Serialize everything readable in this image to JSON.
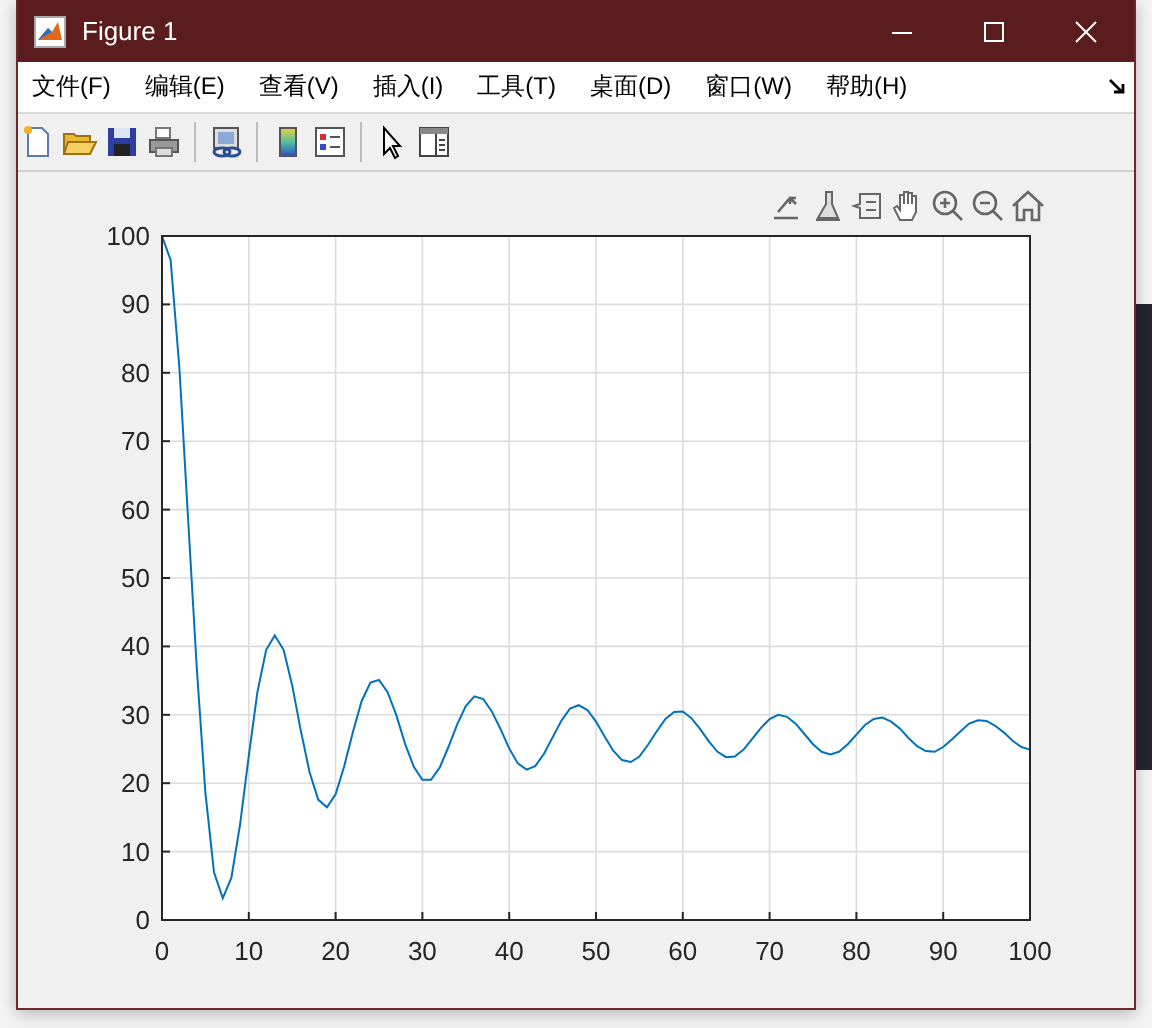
{
  "window": {
    "title": "Figure 1"
  },
  "menu": [
    "文件(F)",
    "编辑(E)",
    "查看(V)",
    "插入(I)",
    "工具(T)",
    "桌面(D)",
    "窗口(W)",
    "帮助(H)"
  ],
  "chart_data": {
    "type": "line",
    "grid": true,
    "xlim": [
      0,
      100
    ],
    "ylim": [
      0,
      100
    ],
    "xticks": [
      0,
      10,
      20,
      30,
      40,
      50,
      60,
      70,
      80,
      90,
      100
    ],
    "yticks": [
      0,
      10,
      20,
      30,
      40,
      50,
      60,
      70,
      80,
      90,
      100
    ],
    "x": [
      0,
      1,
      2,
      3,
      4,
      5,
      6,
      7,
      8,
      9,
      10,
      11,
      12,
      13,
      14,
      15,
      16,
      17,
      18,
      19,
      20,
      21,
      22,
      23,
      24,
      25,
      26,
      27,
      28,
      29,
      30,
      31,
      32,
      33,
      34,
      35,
      36,
      37,
      38,
      39,
      40,
      41,
      42,
      43,
      44,
      45,
      46,
      47,
      48,
      49,
      50,
      51,
      52,
      53,
      54,
      55,
      56,
      57,
      58,
      59,
      60,
      61,
      62,
      63,
      64,
      65,
      66,
      67,
      68,
      69,
      70,
      71,
      72,
      73,
      74,
      75,
      76,
      77,
      78,
      79,
      80,
      81,
      82,
      83,
      84,
      85,
      86,
      87,
      88,
      89,
      90,
      91,
      92,
      93,
      94,
      95,
      96,
      97,
      98,
      99,
      100
    ],
    "series": [
      {
        "color": "#0072bd",
        "values": [
          100,
          96.5,
          80.7,
          58.9,
          36.8,
          18.6,
          7.0,
          3.2,
          6.2,
          14.1,
          24.0,
          33.3,
          39.5,
          41.6,
          39.5,
          34.3,
          27.7,
          21.6,
          17.6,
          16.5,
          18.4,
          22.5,
          27.5,
          32.0,
          34.7,
          35.1,
          33.3,
          29.9,
          25.8,
          22.4,
          20.5,
          20.5,
          22.3,
          25.3,
          28.6,
          31.3,
          32.7,
          32.3,
          30.5,
          27.9,
          25.1,
          22.9,
          22.0,
          22.5,
          24.3,
          26.7,
          29.1,
          30.9,
          31.4,
          30.7,
          29.0,
          26.8,
          24.7,
          23.4,
          23.1,
          23.9,
          25.6,
          27.6,
          29.4,
          30.4,
          30.5,
          29.5,
          27.9,
          26.1,
          24.6,
          23.8,
          23.9,
          24.9,
          26.5,
          28.1,
          29.4,
          30.0,
          29.7,
          28.7,
          27.2,
          25.7,
          24.6,
          24.2,
          24.6,
          25.7,
          27.1,
          28.5,
          29.4,
          29.6,
          29.0,
          28.0,
          26.6,
          25.4,
          24.7,
          24.6,
          25.3,
          26.4,
          27.6,
          28.7,
          29.2,
          29.1,
          28.4,
          27.4,
          26.2,
          25.3,
          24.9
        ]
      }
    ]
  }
}
